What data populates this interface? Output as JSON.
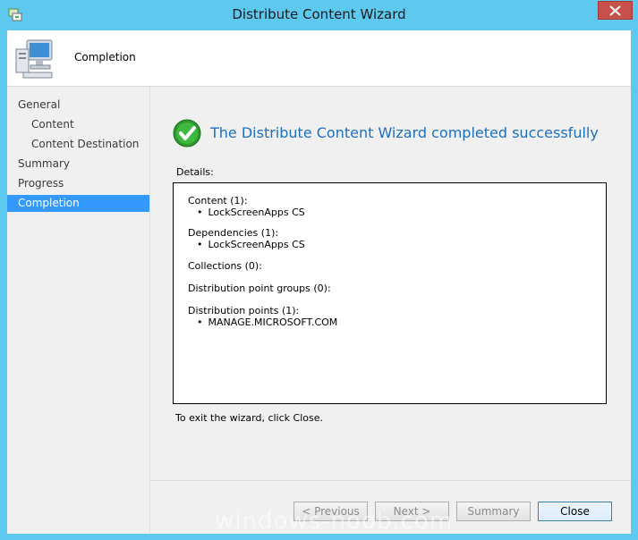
{
  "window": {
    "title": "Distribute Content Wizard"
  },
  "header": {
    "page_title": "Completion"
  },
  "nav": {
    "items": [
      {
        "label": "General"
      },
      {
        "label": "Content"
      },
      {
        "label": "Content Destination"
      },
      {
        "label": "Summary"
      },
      {
        "label": "Progress"
      },
      {
        "label": "Completion"
      }
    ]
  },
  "main": {
    "success_message": "The Distribute Content Wizard completed successfully",
    "details_label": "Details:",
    "details": {
      "content_head": "Content (1):",
      "content_item": "LockScreenApps CS",
      "dependencies_head": "Dependencies (1):",
      "dependencies_item": "LockScreenApps CS",
      "collections_head": "Collections (0):",
      "dp_groups_head": "Distribution point groups (0):",
      "dp_head": "Distribution points (1):",
      "dp_item": "MANAGE.MICROSOFT.COM"
    },
    "exit_text": "To exit the wizard, click Close."
  },
  "buttons": {
    "previous": "< Previous",
    "next": "Next >",
    "summary": "Summary",
    "close": "Close"
  },
  "watermark": "windows-noob.com",
  "colors": {
    "accent": "#5ec9ef",
    "selection": "#3399ff",
    "success_text": "#1e6fc0",
    "close_button": "#c7504b"
  }
}
